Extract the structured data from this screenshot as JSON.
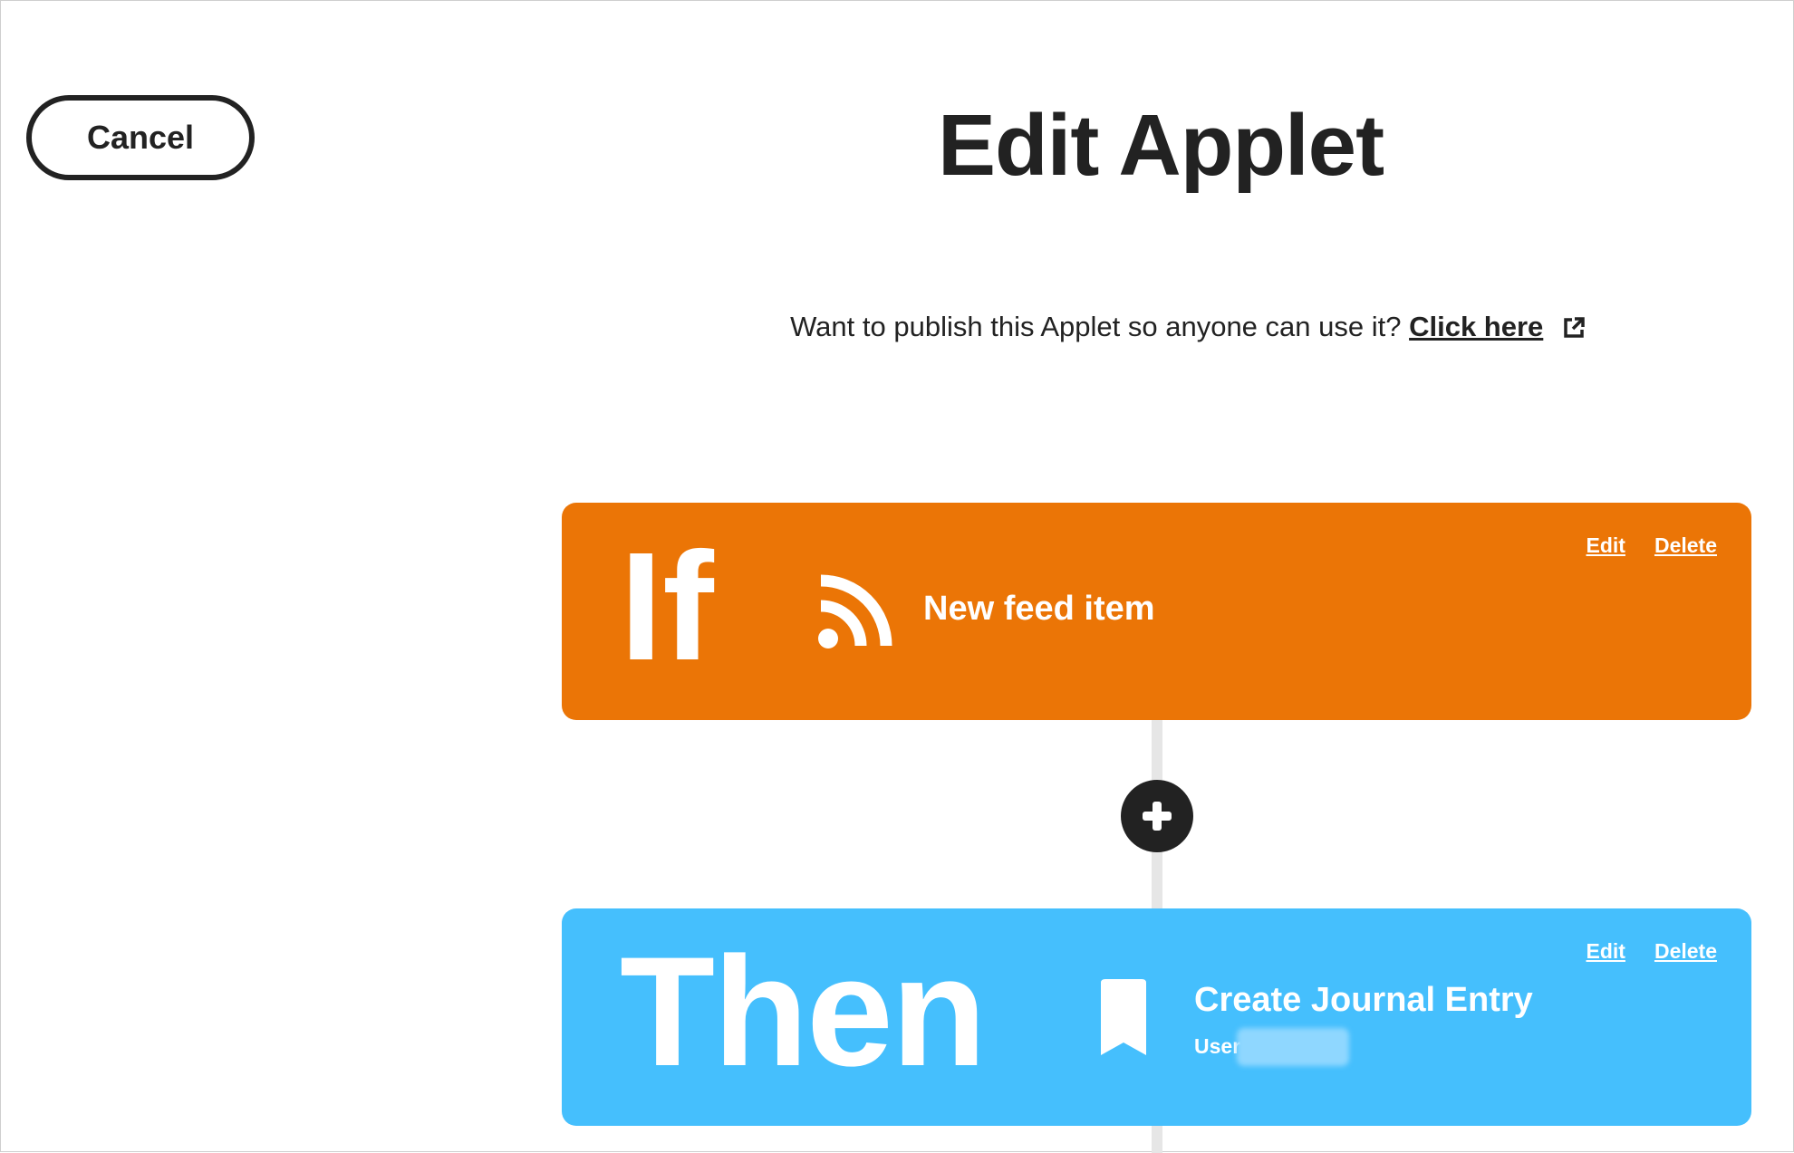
{
  "header": {
    "cancel_label": "Cancel",
    "title": "Edit Applet"
  },
  "publish": {
    "text": "Want to publish this Applet so anyone can use it?",
    "link_label": "Click here"
  },
  "trigger": {
    "keyword": "If",
    "icon": "rss-feed-icon",
    "label": "New feed item",
    "edit_label": "Edit",
    "delete_label": "Delete",
    "color": "#eb7506"
  },
  "add_step": {
    "icon": "plus-icon"
  },
  "action": {
    "keyword": "Then",
    "icon": "bookmark-icon",
    "label": "Create Journal Entry",
    "sub_label": "User",
    "edit_label": "Edit",
    "delete_label": "Delete",
    "color": "#45bffd"
  }
}
